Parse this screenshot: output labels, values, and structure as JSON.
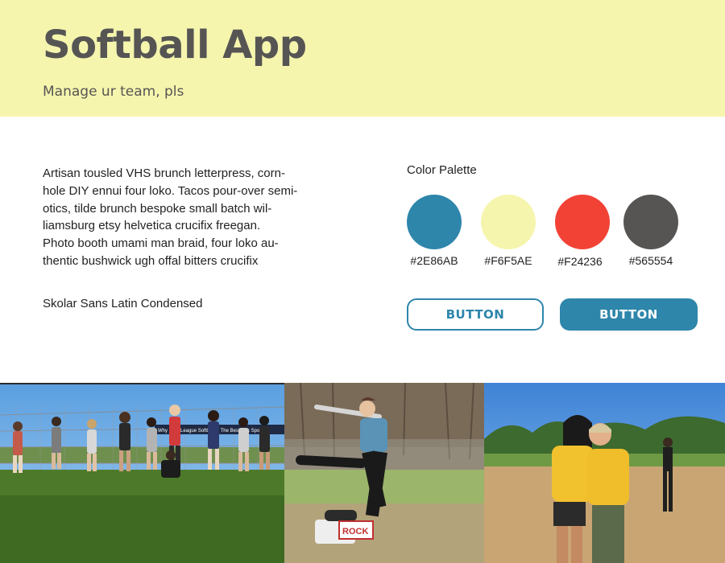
{
  "header": {
    "title": "Softball App",
    "subtitle": "Manage ur team, pls"
  },
  "content": {
    "body_text": "Artisan tousled VHS brunch letterpress, corn- hole DIY ennui four loko. Tacos pour-over semi- otics, tilde brunch bespoke small batch wil- liamsburg etsy helvetica crucifix freegan. Photo booth umami man braid, four loko au- thentic bushwick ugh offal bitters crucifix",
    "body_lines": [
      "Artisan tousled VHS brunch letterpress, corn-",
      "hole DIY ennui four loko. Tacos pour-over semi-",
      "otics, tilde brunch bespoke small batch wil-",
      "liamsburg etsy helvetica crucifix freegan.",
      "Photo booth umami man braid, four loko au-",
      "thentic bushwick ugh offal bitters crucifix"
    ],
    "font_name": "Skolar Sans Latin Condensed"
  },
  "palette": {
    "title": "Color Palette",
    "swatches": [
      {
        "color": "#2E86AB",
        "label": "#2E86AB"
      },
      {
        "color": "#F6F5AE",
        "label": "#F6F5AE"
      },
      {
        "color": "#F24236",
        "label": "#F24236"
      },
      {
        "color": "#565554",
        "label": "#565554"
      }
    ]
  },
  "buttons": {
    "outline_label": "BUTTON",
    "filled_label": "BUTTON"
  },
  "photos": {
    "banner_text": "Why Beer League Softball Is The Best Rec Sport Ar",
    "sign_text": "ROCK"
  }
}
